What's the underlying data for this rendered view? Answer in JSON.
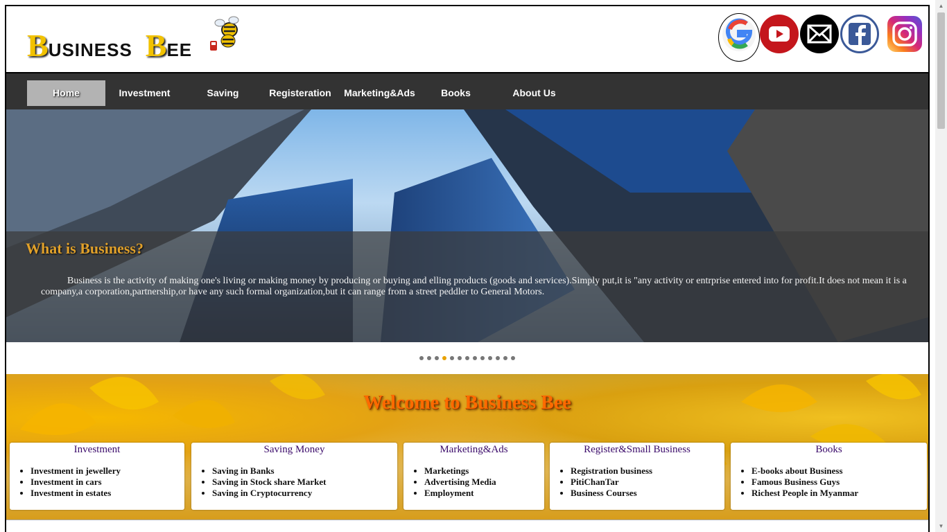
{
  "header": {
    "logo": {
      "b1": "B",
      "usiness": "USINESS",
      "b2": "B",
      "ee": "EE"
    },
    "social": [
      {
        "name": "google-icon",
        "glyph": "G"
      },
      {
        "name": "youtube-icon",
        "glyph": "▶"
      },
      {
        "name": "mail-icon",
        "glyph": "✉"
      },
      {
        "name": "facebook-icon",
        "glyph": "f"
      },
      {
        "name": "instagram-icon",
        "glyph": "◎"
      }
    ]
  },
  "nav": {
    "items": [
      "Home",
      "Investment",
      "Saving",
      "Registeration",
      "Marketing&Ads",
      "Books",
      "About Us"
    ],
    "active": "Home"
  },
  "hero": {
    "title": "What is Business?",
    "text": "Business is the activity of making one's living or making money by producing or buying and elling products (goods and services).Simply put,it is \"any activity or entrprise entered into for profit.It does not mean it is a company,a corporation,partnership,or have any such formal organization,but it can range from a street peddler to General Motors.",
    "slide_count": 13,
    "active_slide": 4
  },
  "welcome": {
    "title": "Welcome to Business Bee",
    "cards": [
      {
        "title": "Investment",
        "items": [
          "Investment in jewellery",
          "Investment in cars",
          "Investment in estates"
        ]
      },
      {
        "title": "Saving Money",
        "items": [
          "Saving in Banks",
          "Saving in Stock share Market",
          "Saving in Cryptocurrency"
        ]
      },
      {
        "title": "Marketing&Ads",
        "items": [
          "Marketings",
          "Advertising Media",
          "Employment"
        ]
      },
      {
        "title": "Register&Small Business",
        "items": [
          "Registration business",
          "PitiChanTar",
          "Business Courses"
        ]
      },
      {
        "title": "Books",
        "items": [
          "E-books about Business",
          "Famous Business Guys",
          "Richest People in Myanmar"
        ]
      }
    ]
  },
  "colors": {
    "nav_bg": "#333333",
    "active_tab": "#b3b3b3",
    "accent": "#e8a100",
    "card_title": "#3a0a6a"
  }
}
